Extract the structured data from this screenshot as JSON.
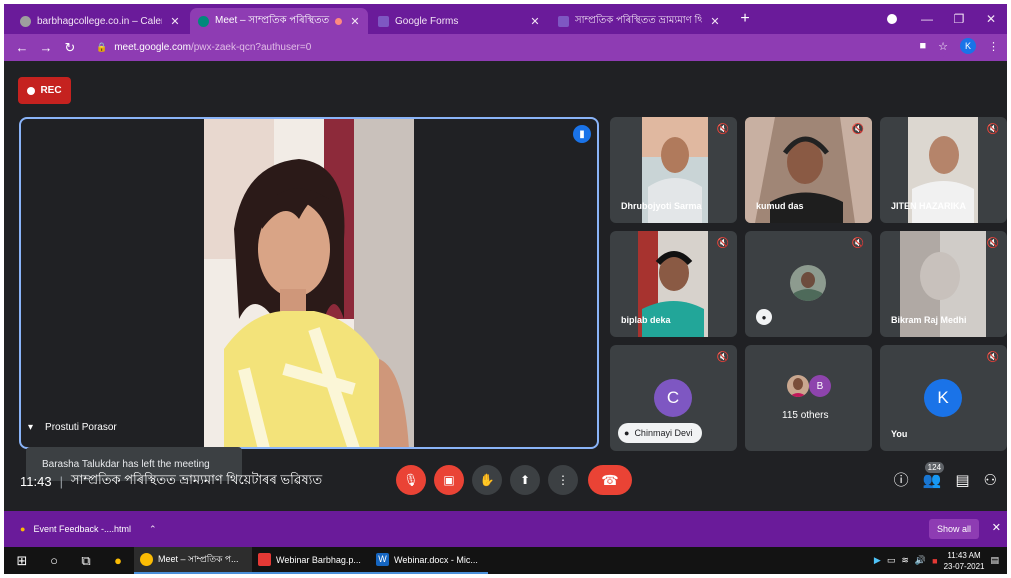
{
  "browser": {
    "tabs": [
      {
        "title": "barbhagcollege.co.in – Calendar",
        "active": false,
        "color": "#9e9e9e"
      },
      {
        "title": "Meet – সাম্প্ৰতিক পৰিস্থিতত",
        "active": true,
        "color": "#00897b"
      },
      {
        "title": "Google Forms",
        "active": false,
        "color": "#7e57c2"
      },
      {
        "title": "সাম্প্ৰতিক পৰিস্থিতত ভ্ৰাম্যমাণ থিয়ে",
        "active": false,
        "color": "#7e57c2"
      }
    ],
    "url_host": "meet.google.com",
    "url_path": "/pwx-zaek-qcn?authuser=0",
    "profile_initial": "K",
    "accent": "#8e3cb3"
  },
  "meet": {
    "rec_label": "REC",
    "main_participant": "Prostuti Porasor",
    "toast": "Barasha Talukdar has left the meeting",
    "participants": [
      {
        "name": "Dhrubojyoti Sarma",
        "type": "video"
      },
      {
        "name": "kumud das",
        "type": "video"
      },
      {
        "name": "JITEN HAZARIKA",
        "type": "video"
      },
      {
        "name": "biplab deka",
        "type": "video"
      },
      {
        "name": "",
        "type": "avatar"
      },
      {
        "name": "Bikram Raj Medhi",
        "type": "video"
      },
      {
        "name": "Chinmayi Devi",
        "type": "letter",
        "letter": "C",
        "color": "#7e57c2"
      },
      {
        "name": "115 others",
        "type": "others",
        "letter": "B"
      },
      {
        "name": "You",
        "type": "letter",
        "letter": "K",
        "color": "#1a73e8"
      }
    ],
    "time": "11:43",
    "meeting_title": "সাম্প্ৰতিক পৰিস্থিতত ভ্ৰাম্যমাণ থিয়েটাৰৰ ভৱিষ্যত",
    "people_count": "124"
  },
  "downloads": {
    "item": "Event Feedback -....html",
    "show_all": "Show all"
  },
  "taskbar": {
    "apps": [
      {
        "label": "Meet – সাম্প্ৰতিক প...",
        "color": "#fbbc04",
        "active": true
      },
      {
        "label": "Webinar Barbhag.p...",
        "color": "#e53935",
        "active": false
      },
      {
        "label": "Webinar.docx - Mic...",
        "color": "#1565c0",
        "active": false
      }
    ],
    "time": "11:43 AM",
    "date": "23-07-2021",
    "word_icon": "W"
  }
}
